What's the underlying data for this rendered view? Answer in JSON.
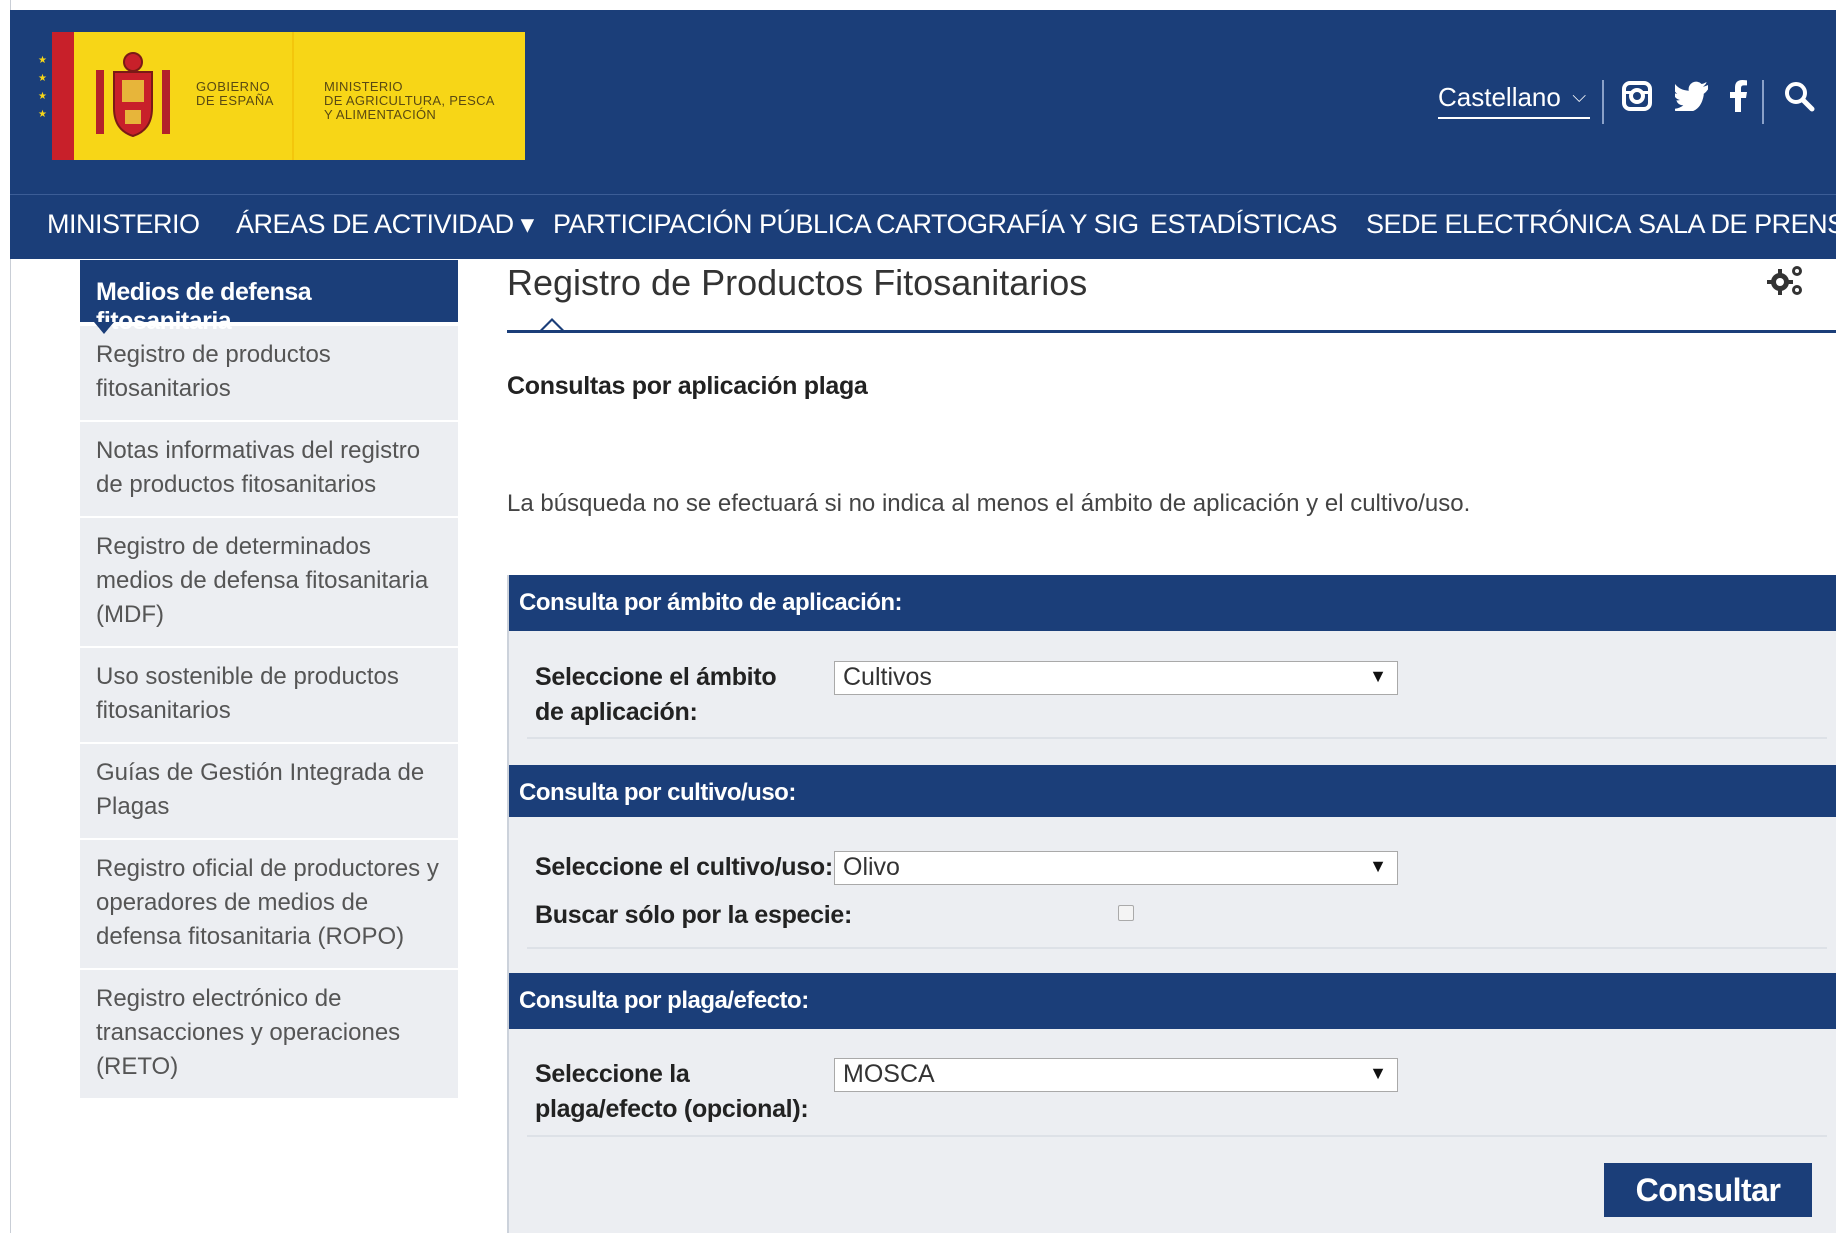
{
  "header": {
    "logo_gobierno": "GOBIERNO\nDE ESPAÑA",
    "logo_ministerio": "MINISTERIO\nDE AGRICULTURA, PESCA\nY ALIMENTACIÓN",
    "language": "Castellano",
    "icons": [
      "instagram-icon",
      "twitter-icon",
      "facebook-icon",
      "search-icon"
    ]
  },
  "nav": {
    "items": [
      "MINISTERIO",
      "ÁREAS DE ACTIVIDAD ▾",
      "PARTICIPACIÓN PÚBLICA",
      "CARTOGRAFÍA Y SIG",
      "ESTADÍSTICAS",
      "SEDE ELECTRÓNICA",
      "SALA DE PRENSA"
    ]
  },
  "sidebar": {
    "heading": "Medios de defensa fitosanitaria",
    "items": [
      "Registro de productos fitosanitarios",
      "Notas informativas del registro de productos fitosanitarios",
      "Registro de determinados medios de defensa fitosanitaria (MDF)",
      "Uso sostenible de productos fitosanitarios",
      "Guías de Gestión Integrada de Plagas",
      "Registro oficial de productores y operadores de medios de defensa fitosanitaria (ROPO)",
      "Registro electrónico de transacciones y operaciones (RETO)"
    ]
  },
  "main": {
    "title": "Registro de Productos Fitosanitarios",
    "subtitle": "Consultas por aplicación plaga",
    "intro": "La búsqueda no se efectuará si no indica al menos el ámbito de aplicación y el cultivo/uso.",
    "sections": {
      "ambito": {
        "heading": "Consulta por ámbito de aplicación:",
        "label": "Seleccione el ámbito de aplicación:",
        "value": "Cultivos"
      },
      "cultivo": {
        "heading": "Consulta por cultivo/uso:",
        "label": "Seleccione el cultivo/uso:",
        "value": "Olivo",
        "check_label": "Buscar sólo por la especie:"
      },
      "plaga": {
        "heading": "Consulta por plaga/efecto:",
        "label": "Seleccione la plaga/efecto (opcional):",
        "value": "MOSCA"
      }
    },
    "submit": "Consultar"
  },
  "colors": {
    "primary": "#1b3e79",
    "logo_yellow": "#f7d617",
    "panel_bg": "#eceef2"
  }
}
